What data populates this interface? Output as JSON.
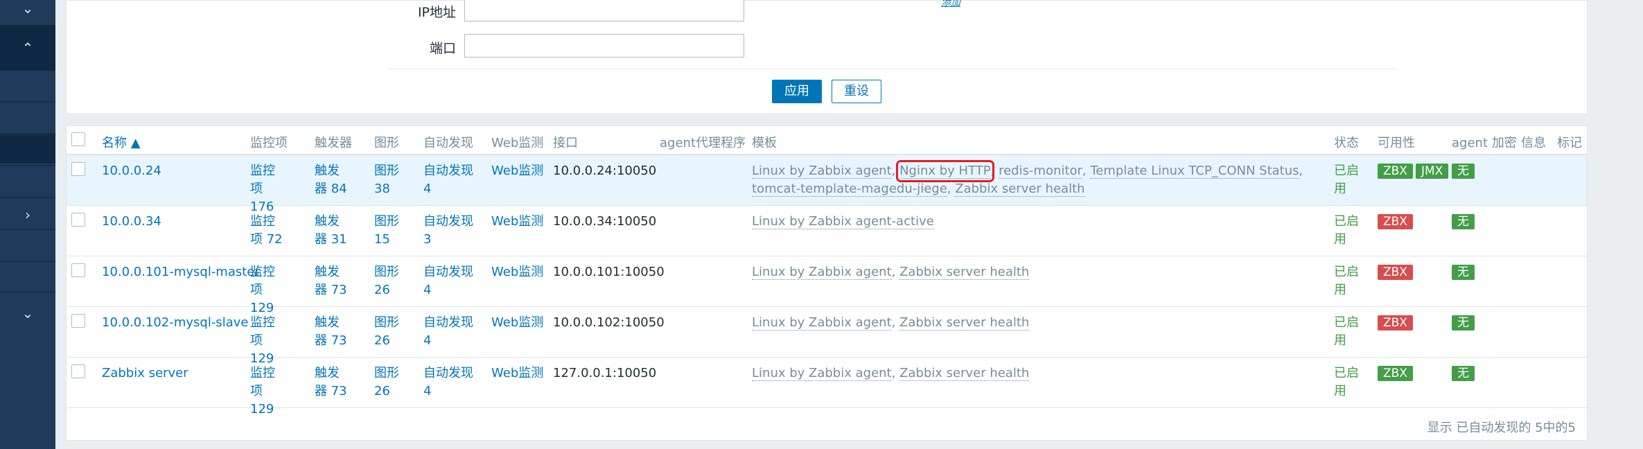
{
  "filter": {
    "ip_label": "IP地址",
    "port_label": "端口",
    "ip_value": "",
    "port_value": "",
    "add_link": "添加",
    "apply": "应用",
    "reset": "重设"
  },
  "table": {
    "headers": {
      "name": "名称 ▲",
      "items": "监控项",
      "triggers": "触发器",
      "graphs": "图形",
      "discovery": "自动发现",
      "web": "Web监测",
      "interface": "接口",
      "proxy": "agent代理程序",
      "templates": "模板",
      "status": "状态",
      "availability": "可用性",
      "encryption": "agent 加密",
      "info": "信息",
      "tags": "标记"
    },
    "rows": [
      {
        "name": "10.0.0.24",
        "items": "监控项 176",
        "triggers": "触发器 84",
        "graphs": "图形 38",
        "discovery": "自动发现 4",
        "web": "Web监测",
        "interface": "10.0.0.24:10050",
        "templates": [
          "Linux by Zabbix agent",
          "Nginx by HTTP",
          "redis-monitor",
          "Template Linux TCP_CONN Status",
          "tomcat-template-magedu-jiege",
          "Zabbix server health"
        ],
        "status": "已启用",
        "availability": [
          "ZBX",
          "JMX"
        ],
        "availability_color": "green",
        "encryption": "无"
      },
      {
        "name": "10.0.0.34",
        "items": "监控项 72",
        "triggers": "触发器 31",
        "graphs": "图形 15",
        "discovery": "自动发现 3",
        "web": "Web监测",
        "interface": "10.0.0.34:10050",
        "templates": [
          "Linux by Zabbix agent-active"
        ],
        "status": "已启用",
        "availability": [
          "ZBX"
        ],
        "availability_color": "red",
        "encryption": "无"
      },
      {
        "name": "10.0.0.101-mysql-master",
        "items": "监控项 129",
        "triggers": "触发器 73",
        "graphs": "图形 26",
        "discovery": "自动发现 4",
        "web": "Web监测",
        "interface": "10.0.0.101:10050",
        "templates": [
          "Linux by Zabbix agent",
          "Zabbix server health"
        ],
        "status": "已启用",
        "availability": [
          "ZBX"
        ],
        "availability_color": "red",
        "encryption": "无"
      },
      {
        "name": "10.0.0.102-mysql-slave",
        "items": "监控项 129",
        "triggers": "触发器 73",
        "graphs": "图形 26",
        "discovery": "自动发现 4",
        "web": "Web监测",
        "interface": "10.0.0.102:10050",
        "templates": [
          "Linux by Zabbix agent",
          "Zabbix server health"
        ],
        "status": "已启用",
        "availability": [
          "ZBX"
        ],
        "availability_color": "red",
        "encryption": "无"
      },
      {
        "name": "Zabbix server",
        "items": "监控项 129",
        "triggers": "触发器 73",
        "graphs": "图形 26",
        "discovery": "自动发现 4",
        "web": "Web监测",
        "interface": "127.0.0.1:10050",
        "templates": [
          "Linux by Zabbix agent",
          "Zabbix server health"
        ],
        "status": "已启用",
        "availability": [
          "ZBX"
        ],
        "availability_color": "green",
        "encryption": "无"
      }
    ],
    "footer": "显示 已自动发现的 5中的5"
  },
  "colors": {
    "link": "#0275b8",
    "green": "#429e47",
    "red": "#d64e4e",
    "sidebar": "#1f3b5c",
    "highlight_box": "#e31c24"
  },
  "sidebar_icons": [
    "chevron-down-icon",
    "chevron-up-icon",
    "chevron-right-icon",
    "chevron-down-icon"
  ]
}
